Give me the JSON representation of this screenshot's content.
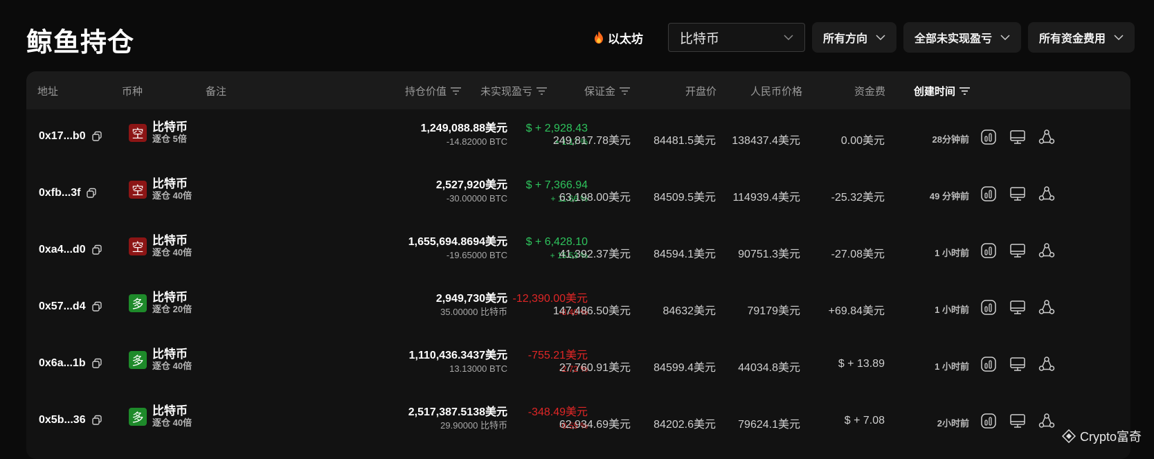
{
  "header": {
    "title": "鲸鱼持仓",
    "chain_link": "以太坊",
    "coin_select": "比特币",
    "filters": [
      "所有方向",
      "全部未实现盈亏",
      "所有资金费用"
    ]
  },
  "columns": {
    "address": "地址",
    "coin": "币种",
    "note": "备注",
    "position_value": "持仓价值",
    "unrealized_pnl": "未实现盈亏",
    "margin": "保证金",
    "open_price": "开盘价",
    "cny_price": "人民币价格",
    "funding_fee": "资金费",
    "created_time": "创建时间"
  },
  "rows": [
    {
      "address": "0x17...b0",
      "side": "空",
      "side_type": "short",
      "coin": "比特币",
      "margin_mode": "逐仓 5倍",
      "position_value": "1,249,088.88美元",
      "position_size": "-14.82000 BTC",
      "pnl": "$ + 2,928.43",
      "pnl_pct": "+ 1.17 %",
      "pnl_sign": "pos",
      "margin": "249,817.78美元",
      "open_price": "84481.5美元",
      "cny_price": "138437.4美元",
      "funding_fee": "0.00美元",
      "fee_sign": "zero",
      "created": "28分钟前"
    },
    {
      "address": "0xfb...3f",
      "side": "空",
      "side_type": "short",
      "coin": "比特币",
      "margin_mode": "逐仓 40倍",
      "position_value": "2,527,920美元",
      "position_size": "-30.00000 BTC",
      "pnl": "$ + 7,366.94",
      "pnl_pct": "+ 11.66 %",
      "pnl_sign": "pos",
      "margin": "63,198.00美元",
      "open_price": "84509.5美元",
      "cny_price": "114939.4美元",
      "funding_fee": "-25.32美元",
      "fee_sign": "neg",
      "created": "49 分钟前"
    },
    {
      "address": "0xa4...d0",
      "side": "空",
      "side_type": "short",
      "coin": "比特币",
      "margin_mode": "逐仓 40倍",
      "position_value": "1,655,694.8694美元",
      "position_size": "-19.65000 BTC",
      "pnl": "$ + 6,428.10",
      "pnl_pct": "+ 15.53 %",
      "pnl_sign": "pos",
      "margin": "41,392.37美元",
      "open_price": "84594.1美元",
      "cny_price": "90751.3美元",
      "funding_fee": "-27.08美元",
      "fee_sign": "neg",
      "created": "1 小时前"
    },
    {
      "address": "0x57...d4",
      "side": "多",
      "side_type": "long",
      "coin": "比特币",
      "margin_mode": "逐仓 20倍",
      "position_value": "2,949,730美元",
      "position_size": "35.00000 比特币",
      "pnl": "-12,390.00美元",
      "pnl_pct": "-8.40 %",
      "pnl_sign": "neg",
      "margin": "147,486.50美元",
      "open_price": "84632美元",
      "cny_price": "79179美元",
      "funding_fee": "+69.84美元",
      "fee_sign": "pos",
      "created": "1 小时前"
    },
    {
      "address": "0x6a...1b",
      "side": "多",
      "side_type": "long",
      "coin": "比特币",
      "margin_mode": "逐仓 40倍",
      "position_value": "1,110,436.3437美元",
      "position_size": "13.13000 BTC",
      "pnl": "-755.21美元",
      "pnl_pct": "-2.72 %",
      "pnl_sign": "neg",
      "margin": "27,760.91美元",
      "open_price": "84599.4美元",
      "cny_price": "44034.8美元",
      "funding_fee": "$ + 13.89",
      "fee_sign": "pos",
      "created": "1 小时前"
    },
    {
      "address": "0x5b...36",
      "side": "多",
      "side_type": "long",
      "coin": "比特币",
      "margin_mode": "逐仓 40倍",
      "position_value": "2,517,387.5138美元",
      "position_size": "29.90000 比特币",
      "pnl": "-348.49美元",
      "pnl_pct": "-0.55 %",
      "pnl_sign": "neg",
      "margin": "62,934.69美元",
      "open_price": "84202.6美元",
      "cny_price": "79624.1美元",
      "funding_fee": "$ + 7.08",
      "fee_sign": "pos",
      "created": "2小时前"
    }
  ],
  "icons": {
    "flame": "flame-icon",
    "chevron": "chevron-down-icon",
    "sort": "sort-filter-icon",
    "copy": "copy-icon",
    "chart": "bar-chart-icon",
    "monitor": "monitor-icon",
    "share": "share-icon"
  },
  "colors": {
    "positive": "#2ec25c",
    "negative": "#e02626",
    "short_badge": "#8c1515",
    "long_badge": "#1e8a2a"
  },
  "watermark": "Crypto富奇"
}
